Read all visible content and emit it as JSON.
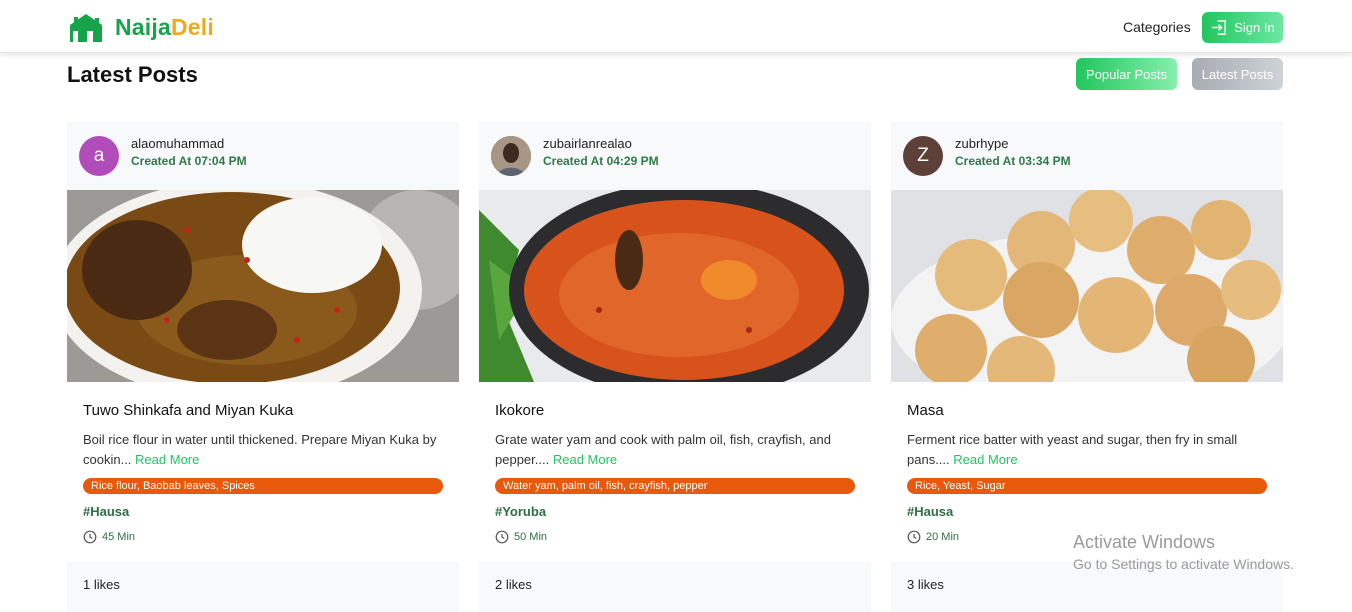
{
  "brand": {
    "part1": "Naija",
    "part2": "Deli",
    "icon": "house-logo-icon",
    "color_primary": "#16a34a",
    "color_accent": "#f0a91c"
  },
  "nav": {
    "categories": "Categories",
    "sign_in": "Sign In",
    "sign_in_icon": "sign-in-icon"
  },
  "main": {
    "title": "Latest Posts",
    "filters": {
      "popular": "Popular Posts",
      "latest": "Latest Posts"
    }
  },
  "posts": [
    {
      "avatar_letter": "a",
      "avatar_color": "#b14dbb",
      "username": "alaomuhammad",
      "created": "Created At 07:04 PM",
      "title": "Tuwo Shinkafa and Miyan Kuka",
      "description": "Boil rice flour in water until thickened. Prepare Miyan Kuka by cookin...",
      "read_more": "Read More",
      "ingredients": "Rice flour, Baobab leaves, Spices",
      "tag": "#Hausa",
      "time": "45 Min",
      "likes": "1 likes"
    },
    {
      "avatar_letter": "",
      "avatar_color": "#5b4a3c",
      "username": "zubairlanrealao",
      "created": "Created At 04:29 PM",
      "title": "Ikokore",
      "description": "Grate water yam and cook with palm oil, fish, crayfish, and pepper....",
      "read_more": "Read More",
      "ingredients": "Water yam, palm oil, fish, crayfish, pepper",
      "tag": "#Yoruba",
      "time": "50 Min",
      "likes": "2 likes"
    },
    {
      "avatar_letter": "Z",
      "avatar_color": "#5d4037",
      "username": "zubrhype",
      "created": "Created At 03:34 PM",
      "title": "Masa",
      "description": "Ferment rice batter with yeast and sugar, then fry in small pans....",
      "read_more": "Read More",
      "ingredients": "Rice, Yeast, Sugar",
      "tag": "#Hausa",
      "time": "20 Min",
      "likes": "3 likes"
    }
  ],
  "windows_watermark": {
    "title": "Activate Windows",
    "subtitle": "Go to Settings to activate Windows."
  }
}
